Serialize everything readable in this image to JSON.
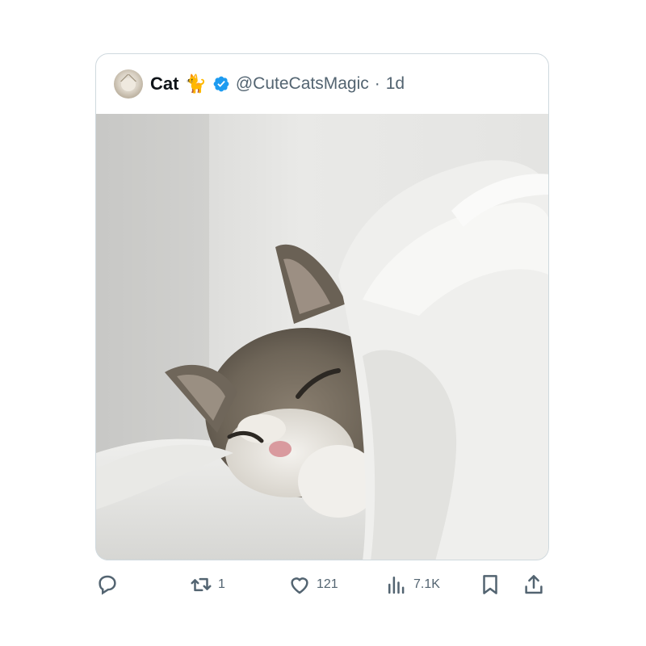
{
  "post": {
    "author_name": "Cat",
    "author_emoji": "🐈",
    "handle": "@CuteCatsMagic",
    "separator": "·",
    "time": "1d"
  },
  "media": {
    "subject": "kitten under white blanket"
  },
  "actions": {
    "reply": {
      "icon": "reply-icon",
      "count": ""
    },
    "retweet": {
      "icon": "retweet-icon",
      "count": "1"
    },
    "like": {
      "icon": "heart-icon",
      "count": "121"
    },
    "views": {
      "icon": "views-icon",
      "count": "7.1K"
    },
    "bookmark": {
      "icon": "bookmark-icon"
    },
    "share": {
      "icon": "share-icon"
    }
  },
  "colors": {
    "verified": "#1d9bf0",
    "secondary_text": "#536471",
    "border": "#cfd9de"
  }
}
